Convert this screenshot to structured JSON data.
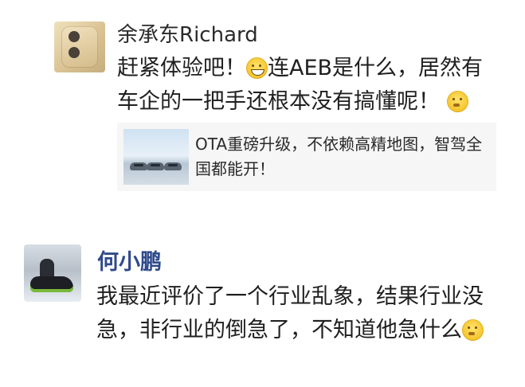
{
  "posts": [
    {
      "author": "余承东Richard",
      "message_parts": {
        "a": "赶紧体验吧！",
        "b": "连AEB是什么，居然有车企的一把手还根本没有搞懂呢！"
      },
      "link_card": {
        "title": "OTA重磅升级，不依赖高精地图，智驾全国都能开！"
      }
    },
    {
      "author": "何小鹏",
      "message_parts": {
        "a": "我最近评价了一个行业乱象，结果行业没急，非行业的倒急了，不知道他急什么"
      }
    }
  ],
  "icons": {
    "grin_emoji": "grinning-face-icon",
    "thinking_emoji": "thinking-face-icon"
  }
}
